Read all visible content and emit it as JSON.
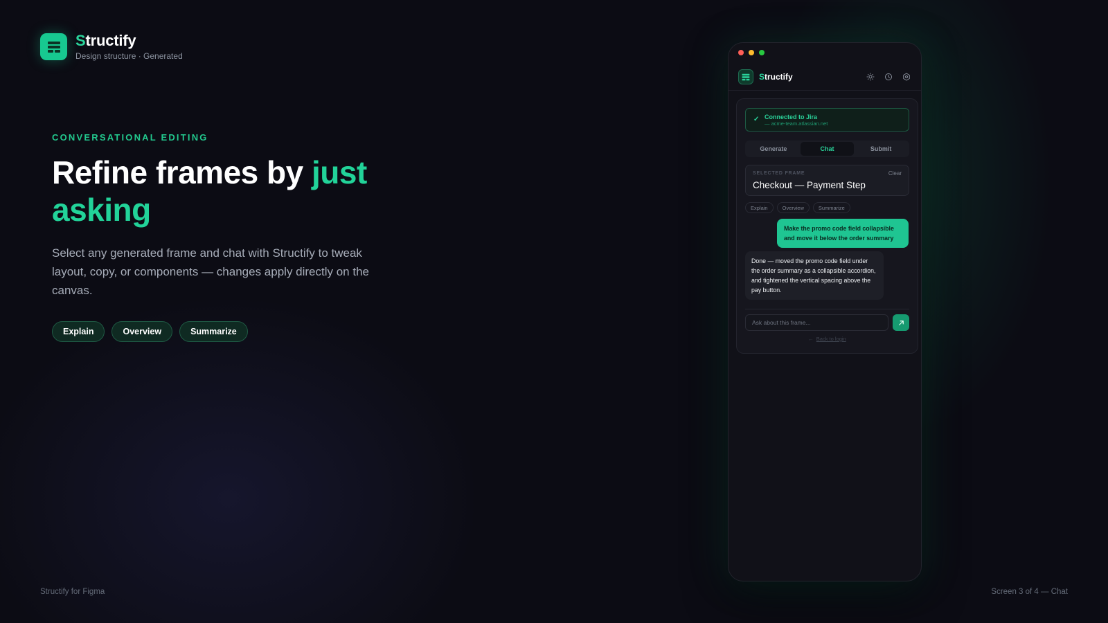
{
  "brand": {
    "name_first": "S",
    "name_rest": "tructify",
    "subtitle": "Design structure · Generated",
    "logo_icon": "layers-icon",
    "accent_color": "#22d399"
  },
  "hero": {
    "eyebrow": "CONVERSATIONAL EDITING",
    "headline_plain": "Refine frames by ",
    "headline_accent": "just asking",
    "description": "Select any generated frame and chat with Structify to tweak layout, copy, or components — changes apply directly on the canvas.",
    "pills": [
      "Explain",
      "Overview",
      "Summarize"
    ]
  },
  "footer": {
    "left": "Structify for Figma",
    "right": "Screen 3 of 4 — Chat"
  },
  "plugin": {
    "title_first": "S",
    "title_rest": "tructify",
    "header_icons": [
      "sun-icon",
      "history-icon",
      "settings-icon"
    ],
    "connection": {
      "title": "Connected to  Jira",
      "subtitle": "— acme-team.atlassian.net"
    },
    "tabs": [
      "Generate",
      "Chat",
      "Submit"
    ],
    "active_tab": "Chat",
    "selected_frame": {
      "label": "SELECTED FRAME",
      "clear": "Clear",
      "title": "Checkout — Payment Step"
    },
    "quick_actions": [
      "Explain",
      "Overview",
      "Summarize"
    ],
    "messages": {
      "user": "Make the promo code field collapsible and move it below the order summary",
      "assistant": "Done — moved the promo code field under the order summary as a collapsible accordion, and tightened the vertical spacing above the pay button."
    },
    "input_placeholder": "Ask about this frame...",
    "back_link": "Back to login"
  }
}
